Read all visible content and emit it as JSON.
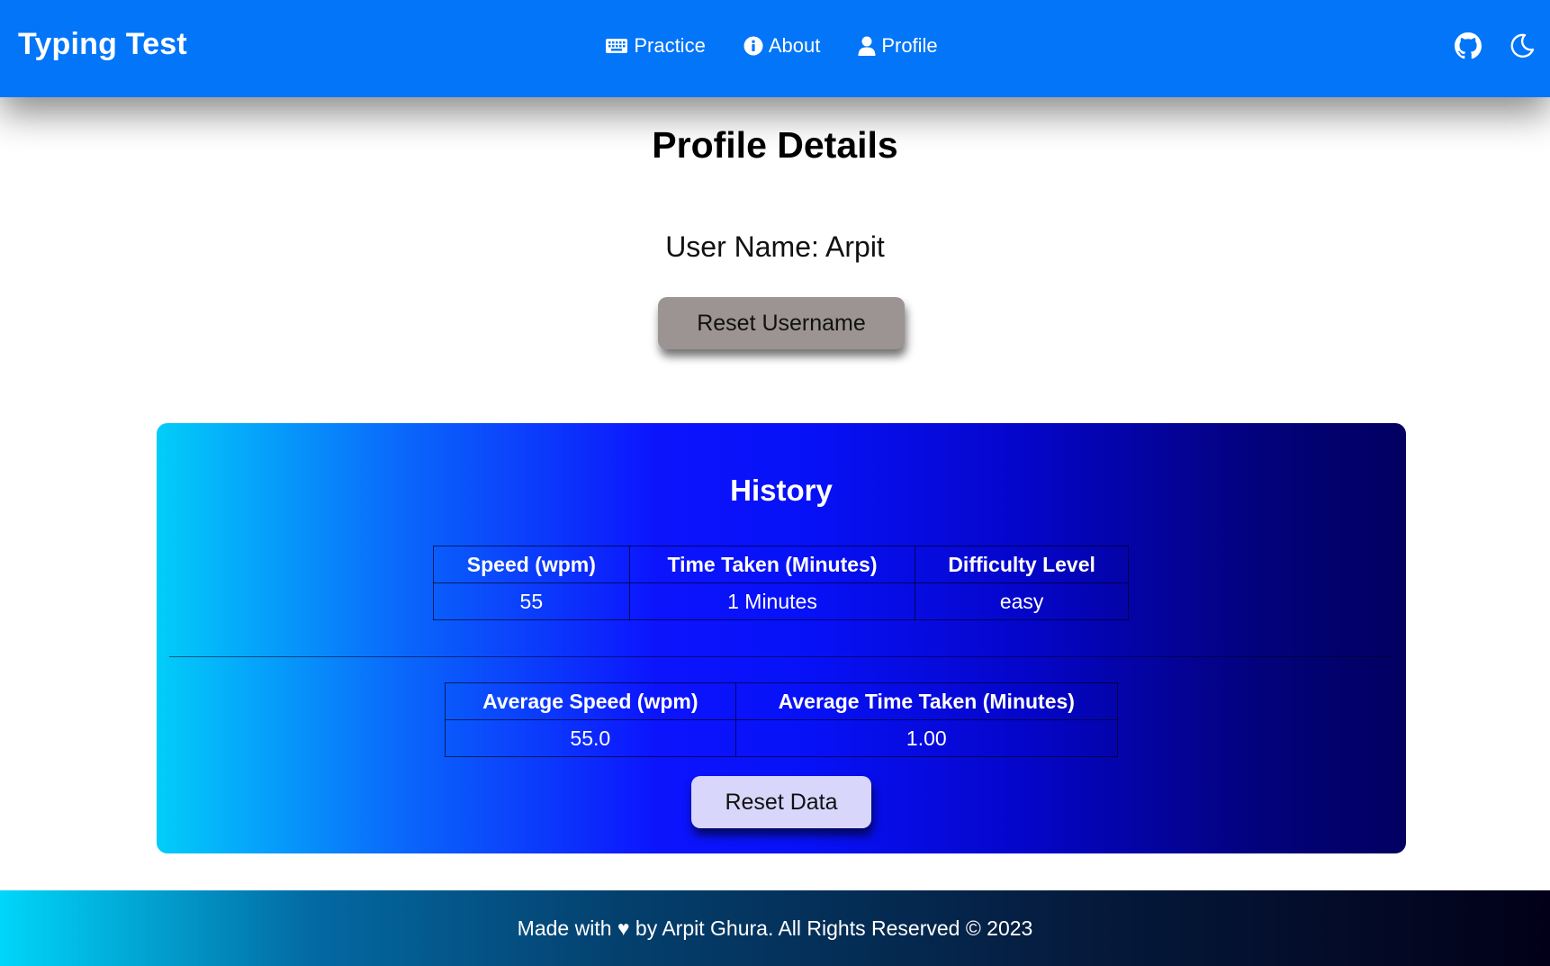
{
  "navbar": {
    "brand": "Typing Test",
    "links": [
      {
        "label": "Practice",
        "icon": "keyboard-icon"
      },
      {
        "label": "About",
        "icon": "info-icon"
      },
      {
        "label": "Profile",
        "icon": "user-icon"
      }
    ],
    "right_icons": [
      "github-icon",
      "moon-icon"
    ],
    "color": "#0275f8"
  },
  "profile": {
    "title": "Profile Details",
    "username_text": "User Name: Arpit",
    "reset_username_label": "Reset Username"
  },
  "history": {
    "title": "History",
    "columns": [
      "Speed (wpm)",
      "Time Taken (Minutes)",
      "Difficulty Level"
    ],
    "rows": [
      [
        "55",
        "1 Minutes",
        "easy"
      ]
    ],
    "average_columns": [
      "Average Speed (wpm)",
      "Average Time Taken (Minutes)"
    ],
    "average_values": [
      "55.0",
      "1.00"
    ],
    "reset_data_label": "Reset Data"
  },
  "footer": {
    "text": "Made with ♥ by Arpit Ghura. All Rights Reserved © 2023"
  }
}
